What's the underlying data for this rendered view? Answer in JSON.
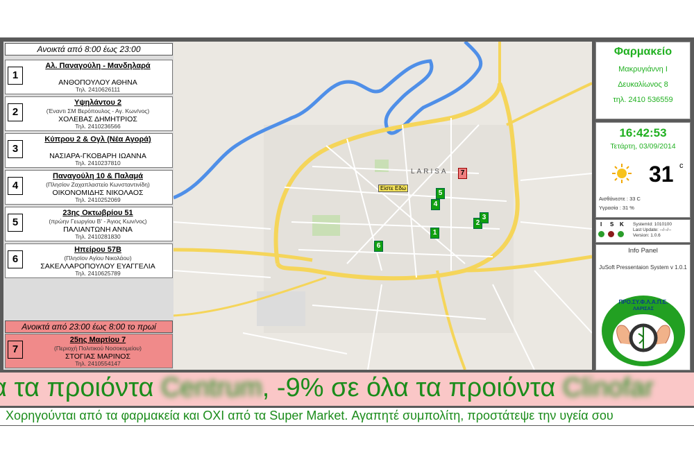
{
  "left_panel": {
    "day_hours": "Ανοικτά από  8:00 έως 23:00",
    "night_hours": "Ανοικτά από  23:00  έως 8:00 το πρωί",
    "pharmacies": [
      {
        "number": "1",
        "address": "Αλ. Παναγούλη - Μανδηλαρά",
        "note": "",
        "name": "ΑΝΘΟΠΟΥΛΟΥ ΑΘΗΝΑ",
        "phone": "Τηλ. 2410626111"
      },
      {
        "number": "2",
        "address": "Υψηλάντου 2",
        "note": "(Έναντι ΣΜ Βερόπουλος - Αγ. Κων/νος)",
        "name": "ΧΟΛΕΒΑΣ ΔΗΜΗΤΡΙΟΣ",
        "phone": "Τηλ. 2410236566"
      },
      {
        "number": "3",
        "address": "Κύπρου 2 & Ογλ (Νέα Αγορά)",
        "note": "",
        "name": "ΝΑΣΙΑΡΑ-ΓΚΟΒΑΡΗ ΙΩΑΝΝΑ",
        "phone": "Τηλ. 2410237810"
      },
      {
        "number": "4",
        "address": "Παναγούλη 10 & Παλαμά",
        "note": "(Πλησίον Ζαχαπλαστείο  Κωνσταντινίδη)",
        "name": "ΟΙΚΟΝΟΜΙΔΗΣ ΝΙΚΟΛΑΟΣ",
        "phone": "Τηλ. 2410252069"
      },
      {
        "number": "5",
        "address": "23ης Οκτωβρίου 51",
        "note": "(πρώην Γεωργίου Β' - Άγιος Κων/νος)",
        "name": "ΠΑΛΙΑΝΤΩΝΗ ΑΝΝΑ",
        "phone": "Τηλ. 2410281830"
      },
      {
        "number": "6",
        "address": "Ηπείρου 57Β",
        "note": "(Πλησίον Αγίου  Νικολάου)",
        "name": "ΣΑΚΕΛΛΑΡΟΠΟΥΛΟΥ ΕΥΑΓΓΕΛΙΑ",
        "phone": "Τηλ. 2410625789"
      }
    ],
    "night_pharmacy": {
      "number": "7",
      "address": "25ης Μαρτίου 7",
      "note": "(Περιοχή Πολιτικού Νοσοκομείου)",
      "name": "ΣΤΟΓΙΑΣ ΜΑΡΙΝΟΣ",
      "phone": "Τηλ. 2410554147"
    }
  },
  "map": {
    "you_are_here": "Είστε Εδώ",
    "city_label": "LARISA",
    "markers": [
      "1",
      "2",
      "3",
      "4",
      "5",
      "6",
      "7"
    ]
  },
  "info": {
    "title": "Φαρμακείο",
    "line1": "Μακρυγιάννη Ι",
    "line2": "Δευκαλίωνος 8",
    "line3": "τηλ. 2410 536559"
  },
  "clock": {
    "time": "16:42:53",
    "date": "Τετάρτη, 03/09/2014"
  },
  "weather": {
    "icon": "sun-icon",
    "temperature": "31",
    "unit": "c",
    "feels_like": "Αισθάνεστε : 33 C",
    "humidity": "Υγρασία : 31 %"
  },
  "system": {
    "letters": [
      "I",
      "S",
      "K"
    ],
    "dots": [
      "#2a9d2a",
      "#8b1a1a",
      "#2a9d2a"
    ],
    "system_id": "SystemId: 1010100",
    "last_update": "Last Update: --/--/--",
    "version": "Version: 1.0.6",
    "info_title": "Info Panel",
    "info_sub": "JuSoft Pressentaion System v 1.0.1"
  },
  "logo": {
    "text_top": "ΠΡΟ.ΣΥ.Φ.Λ.Α.Π.Ε.",
    "text_bottom": "ΛΑΡΙΣΑΣ"
  },
  "ticker": {
    "part1": "α τα προιόντα ",
    "blur1": "Centrum",
    "part2": ", -9% σε όλα τα προιόντα ",
    "blur2": "Clinofar",
    "line2": "Χορηγούνται από τα φαρμακεία και ΟΧΙ από τα Super Market. Αγαπητέ συμπολίτη, προστάτεψε την υγεία σου"
  },
  "colors": {
    "accent_green": "#20b020",
    "night_red": "#f08a8a",
    "ticker_bg": "#fac7c7"
  }
}
